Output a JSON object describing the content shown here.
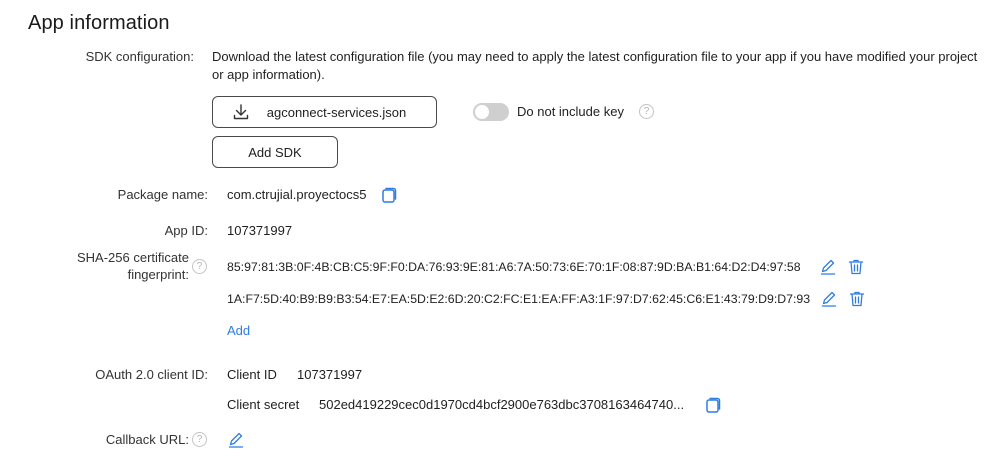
{
  "section_title": "App information",
  "sdk": {
    "label": "SDK configuration:",
    "description": "Download the latest configuration file (you may need to apply the latest configuration file to your app if you have modified your project or app information).",
    "download_button": "agconnect-services.json",
    "toggle_label": "Do not include key",
    "toggle_on": false,
    "add_sdk_button": "Add SDK"
  },
  "package": {
    "label": "Package name:",
    "value": "com.ctrujial.proyectocs5"
  },
  "app_id": {
    "label": "App ID:",
    "value": "107371997"
  },
  "sha": {
    "label_line1": "SHA-256 certificate",
    "label_line2": "fingerprint:",
    "fingerprints": [
      "85:97:81:3B:0F:4B:CB:C5:9F:F0:DA:76:93:9E:81:A6:7A:50:73:6E:70:1F:08:87:9D:BA:B1:64:D2:D4:97:58",
      "1A:F7:5D:40:B9:B9:B3:54:E7:EA:5D:E2:6D:20:C2:FC:E1:EA:FF:A3:1F:97:D7:62:45:C6:E1:43:79:D9:D7:93"
    ],
    "add_link": "Add"
  },
  "oauth": {
    "label": "OAuth 2.0 client ID:",
    "client_id_label": "Client ID",
    "client_id_value": "107371997",
    "client_secret_label": "Client secret",
    "client_secret_value": "502ed419229cec0d1970cd4bcf2900e763dbc3708163464740..."
  },
  "callback": {
    "label": "Callback URL:"
  },
  "colors": {
    "link": "#2e7ce3",
    "icon": "#2e7ce3",
    "toggle_off": "#cfcfcf"
  }
}
